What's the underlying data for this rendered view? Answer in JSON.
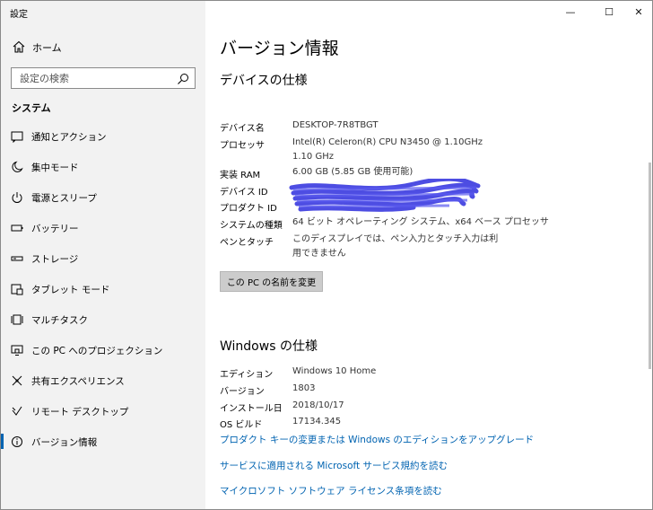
{
  "window": {
    "app_title": "設定",
    "minimize": "—",
    "maximize": "☐",
    "close": "✕"
  },
  "sidebar": {
    "home_label": "ホーム",
    "search_placeholder": "設定の検索",
    "section_title": "システム",
    "items": [
      {
        "label": "通知とアクション",
        "icon": "notification-icon"
      },
      {
        "label": "集中モード",
        "icon": "moon-icon"
      },
      {
        "label": "電源とスリープ",
        "icon": "power-icon"
      },
      {
        "label": "バッテリー",
        "icon": "battery-icon"
      },
      {
        "label": "ストレージ",
        "icon": "storage-icon"
      },
      {
        "label": "タブレット モード",
        "icon": "tablet-icon"
      },
      {
        "label": "マルチタスク",
        "icon": "multitask-icon"
      },
      {
        "label": "この PC へのプロジェクション",
        "icon": "projection-icon"
      },
      {
        "label": "共有エクスペリエンス",
        "icon": "share-icon"
      },
      {
        "label": "リモート デスクトップ",
        "icon": "remote-icon"
      },
      {
        "label": "バージョン情報",
        "icon": "info-icon",
        "active": true
      }
    ]
  },
  "main": {
    "title": "バージョン情報",
    "device_section": {
      "heading": "デバイスの仕様",
      "rows": [
        {
          "label": "デバイス名",
          "value": "DESKTOP-7R8TBGT"
        },
        {
          "label": "プロセッサ",
          "value": "Intel(R) Celeron(R) CPU N3450 @ 1.10GHz   1.10 GHz"
        },
        {
          "label": "実装 RAM",
          "value": "6.00 GB (5.85 GB 使用可能)"
        },
        {
          "label": "デバイス ID",
          "value": ""
        },
        {
          "label": "プロダクト ID",
          "value": ""
        },
        {
          "label": "システムの種類",
          "value": "64 ビット オペレーティング システム、x64 ベース プロセッサ"
        },
        {
          "label": "ペンとタッチ",
          "value": "このディスプレイでは、ペン入力とタッチ入力は利用できません"
        }
      ],
      "rename_button": "この PC の名前を変更"
    },
    "windows_section": {
      "heading": "Windows の仕様",
      "rows": [
        {
          "label": "エディション",
          "value": "Windows 10 Home"
        },
        {
          "label": "バージョン",
          "value": "1803"
        },
        {
          "label": "インストール日",
          "value": "2018/10/17"
        },
        {
          "label": "OS ビルド",
          "value": "17134.345"
        }
      ]
    },
    "links": [
      "プロダクト キーの変更または Windows のエディションをアップグレード",
      "サービスに適用される Microsoft サービス規約を読む",
      "マイクロソフト ソフトウェア ライセンス条項を読む"
    ]
  },
  "colors": {
    "accent": "#0063b1",
    "sidebar_bg": "#f2f2f2",
    "button_bg": "#cccccc",
    "redaction": "#3a3adf"
  }
}
